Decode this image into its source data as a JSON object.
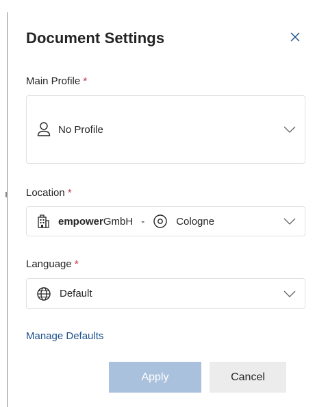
{
  "dialog": {
    "title": "Document Settings",
    "close_icon": "close-icon"
  },
  "main_profile": {
    "label": "Main Profile",
    "required_mark": "*",
    "value": "No Profile",
    "icon": "person-icon"
  },
  "location": {
    "label": "Location",
    "required_mark": "*",
    "company_bold": "empower",
    "company_rest": "GmbH",
    "separator": "-",
    "city": "Cologne",
    "building_icon": "building-icon",
    "pin_icon": "location-pin-icon"
  },
  "language": {
    "label": "Language",
    "required_mark": "*",
    "value": "Default",
    "icon": "globe-icon"
  },
  "links": {
    "manage_defaults": "Manage Defaults"
  },
  "buttons": {
    "apply": "Apply",
    "cancel": "Cancel"
  },
  "colors": {
    "required": "#c4314b",
    "link": "#1a4f8b",
    "apply_disabled_bg": "#a9c1dc",
    "cancel_bg": "#ececec"
  }
}
